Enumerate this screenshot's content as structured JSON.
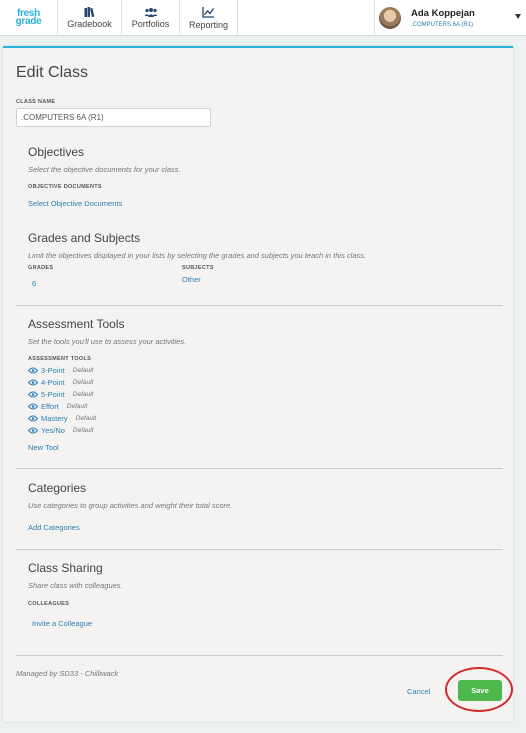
{
  "brand": {
    "line1": "fresh",
    "line2": "grade",
    "color": "#2bb3d9"
  },
  "nav": [
    {
      "label": "Gradebook",
      "icon": "books-icon"
    },
    {
      "label": "Portfolios",
      "icon": "people-icon"
    },
    {
      "label": "Reporting",
      "icon": "chart-line-icon"
    }
  ],
  "user": {
    "name": "Ada Koppejan",
    "class": ".COMPUTERS 6A (R1)"
  },
  "page_title": "Edit Class",
  "class_name": {
    "label": "CLASS NAME",
    "value": ".COMPUTERS 6A (R1)"
  },
  "objectives": {
    "title": "Objectives",
    "desc": "Select the objective documents for your class.",
    "docs_label": "OBJECTIVE DOCUMENTS",
    "link": "Select Objective Documents"
  },
  "grades_subjects": {
    "title": "Grades and Subjects",
    "desc": "Limit the objectives displayed in your lists by selecting the grades and subjects you teach in this class.",
    "grades_label": "GRADES",
    "grades_value": "6",
    "subjects_label": "SUBJECTS",
    "subjects_value": "Other"
  },
  "assessment": {
    "title": "Assessment Tools",
    "desc": "Set the tools you'll use to assess your activities.",
    "tools_label": "ASSESSMENT TOOLS",
    "tools": [
      {
        "name": "3-Point",
        "tag": "Default"
      },
      {
        "name": "4-Point",
        "tag": "Default"
      },
      {
        "name": "5-Point",
        "tag": "Default"
      },
      {
        "name": "Effort",
        "tag": "Default"
      },
      {
        "name": "Mastery",
        "tag": "Default"
      },
      {
        "name": "Yes/No",
        "tag": "Default"
      }
    ],
    "new_tool": "New Tool"
  },
  "categories": {
    "title": "Categories",
    "desc": "Use categories to group activities and weight their total score.",
    "link": "Add Categories"
  },
  "sharing": {
    "title": "Class Sharing",
    "desc": "Share class with colleagues.",
    "colleagues_label": "COLLEAGUES",
    "link": "Invite a Colleague"
  },
  "footer": {
    "managed": "Managed by SD33 - Chilliwack",
    "cancel": "Cancel",
    "save": "Save"
  },
  "colors": {
    "accent": "#2bb3d9",
    "link": "#2e7fb3",
    "save": "#4cb84e",
    "highlight": "#d12b2b"
  }
}
